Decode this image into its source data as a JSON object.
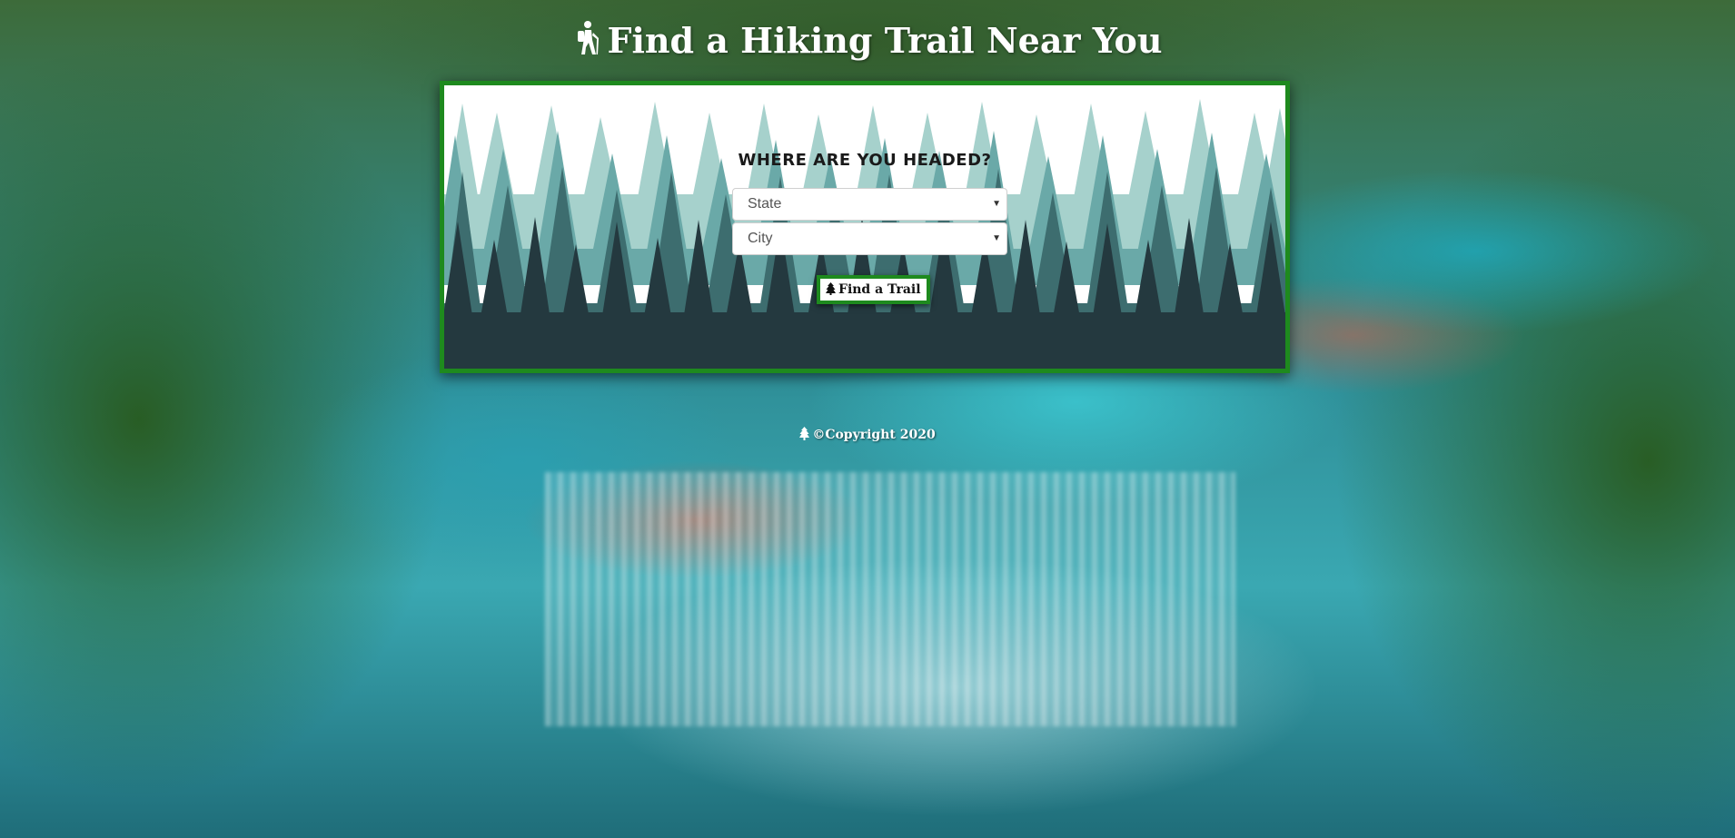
{
  "header": {
    "title": "Find a Hiking Trail Near You",
    "icon": "hiker-icon"
  },
  "search_panel": {
    "headline": "Where are you headed?",
    "state_select": {
      "value": "State"
    },
    "city_select": {
      "value": "City"
    },
    "submit_button": {
      "label": "Find a Trail",
      "icon": "tree-icon"
    }
  },
  "footer": {
    "text": "©Copyright 2020",
    "icon": "tree-icon"
  },
  "colors": {
    "accent_border": "#1e8a1e",
    "title_text": "#ffffff"
  }
}
